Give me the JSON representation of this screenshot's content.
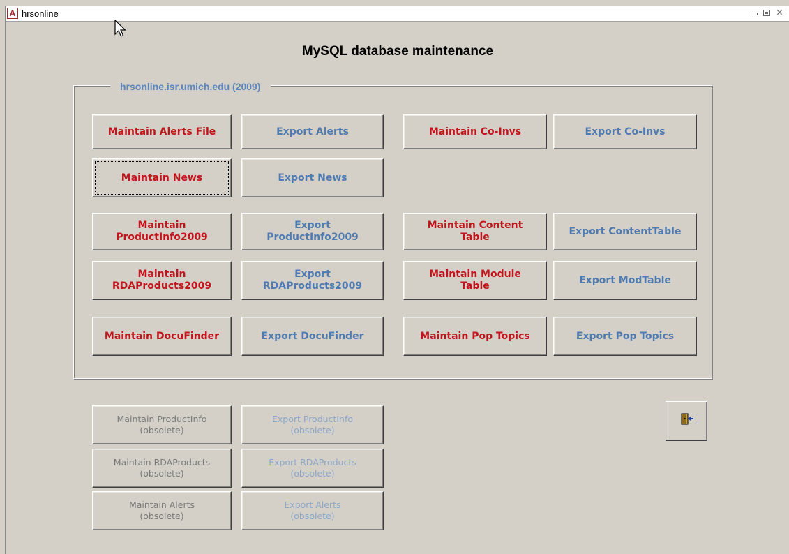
{
  "window": {
    "title": "hrsonline",
    "app_icon_letter": "A"
  },
  "heading": "MySQL database maintenance",
  "group": {
    "label": "hrsonline.isr.umich.edu (2009)"
  },
  "buttons": {
    "maintain_alerts_file": "Maintain Alerts File",
    "export_alerts": "Export Alerts",
    "maintain_co_invs": "Maintain Co-Invs",
    "export_co_invs": "Export Co-Invs",
    "maintain_news": "Maintain News",
    "export_news": "Export News",
    "maintain_productinfo2009": "Maintain\nProductInfo2009",
    "export_productinfo2009": "Export\nProductInfo2009",
    "maintain_content_table": "Maintain Content\nTable",
    "export_contenttable": "Export ContentTable",
    "maintain_rdaproducts2009": "Maintain\nRDAProducts2009",
    "export_rdaproducts2009": "Export\nRDAProducts2009",
    "maintain_module_table": "Maintain Module\nTable",
    "export_modtable": "Export ModTable",
    "maintain_docufinder": "Maintain DocuFinder",
    "export_docufinder": "Export DocuFinder",
    "maintain_pop_topics": "Maintain Pop Topics",
    "export_pop_topics": "Export Pop Topics"
  },
  "obsolete_buttons": {
    "maintain_productinfo": "Maintain ProductInfo\n(obsolete)",
    "export_productinfo": "Export ProductInfo\n(obsolete)",
    "maintain_rdaproducts": "Maintain RDAProducts\n(obsolete)",
    "export_rdaproducts": "Export RDAProducts\n(obsolete)",
    "maintain_alerts": "Maintain Alerts\n(obsolete)",
    "export_alerts": "Export Alerts\n(obsolete)"
  },
  "colors": {
    "maintain_text": "#c0151c",
    "export_text": "#4f7bb0",
    "group_label": "#5b86bd",
    "background": "#d4d0c8"
  },
  "icons": {
    "exit": "exit-door-icon"
  }
}
